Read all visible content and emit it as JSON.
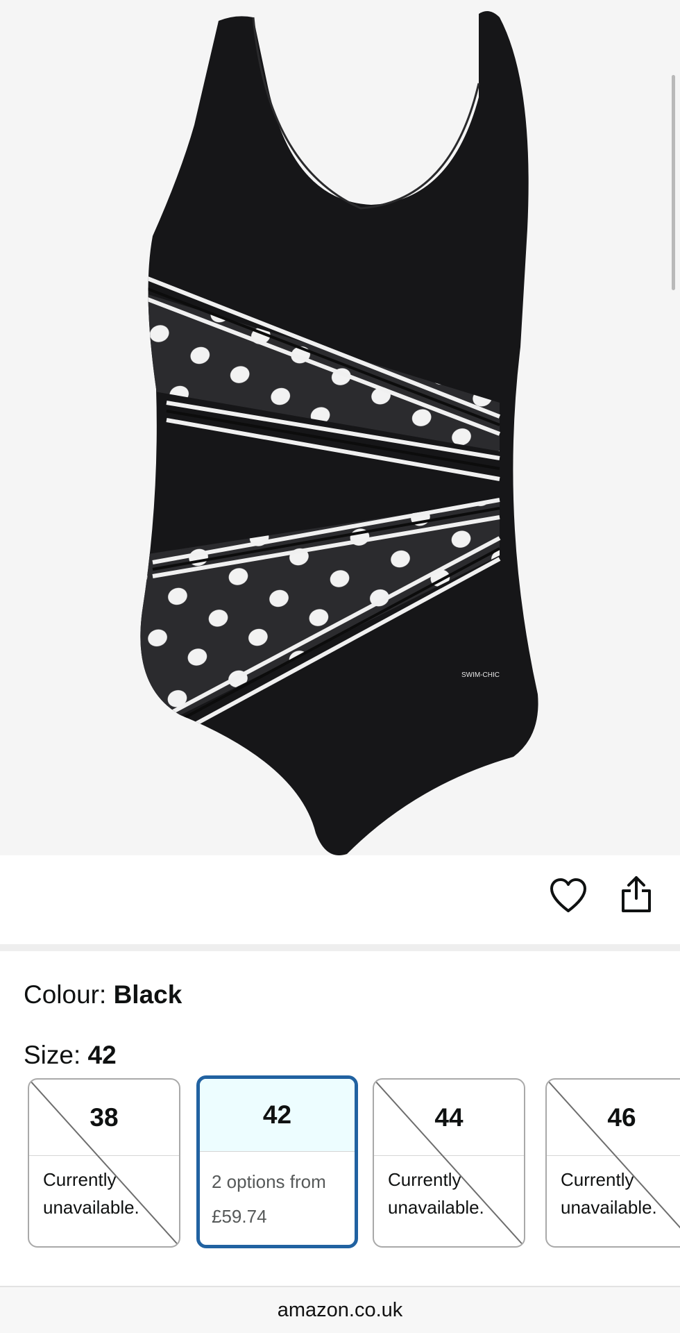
{
  "product": {
    "image_alt": "Black polka dot swimsuit",
    "brand_print": "SWIM-CHIC"
  },
  "actions": {
    "wishlist_icon": "heart-icon",
    "share_icon": "share-icon"
  },
  "colour": {
    "label": "Colour: ",
    "value": "Black"
  },
  "size": {
    "label": "Size: ",
    "value": "42",
    "options": [
      {
        "size": "38",
        "status": "Currently unavailable.",
        "available": false
      },
      {
        "size": "42",
        "status_line1": "2 options from",
        "status_line2": "£59.74",
        "available": true,
        "selected": true
      },
      {
        "size": "44",
        "status": "Currently unavailable.",
        "available": false
      },
      {
        "size": "46",
        "status": "Currently unavailable.",
        "available": false
      }
    ]
  },
  "browser": {
    "domain": "amazon.co.uk"
  },
  "colors": {
    "selected_border": "#2162a1",
    "selected_bg": "#edfdff"
  }
}
